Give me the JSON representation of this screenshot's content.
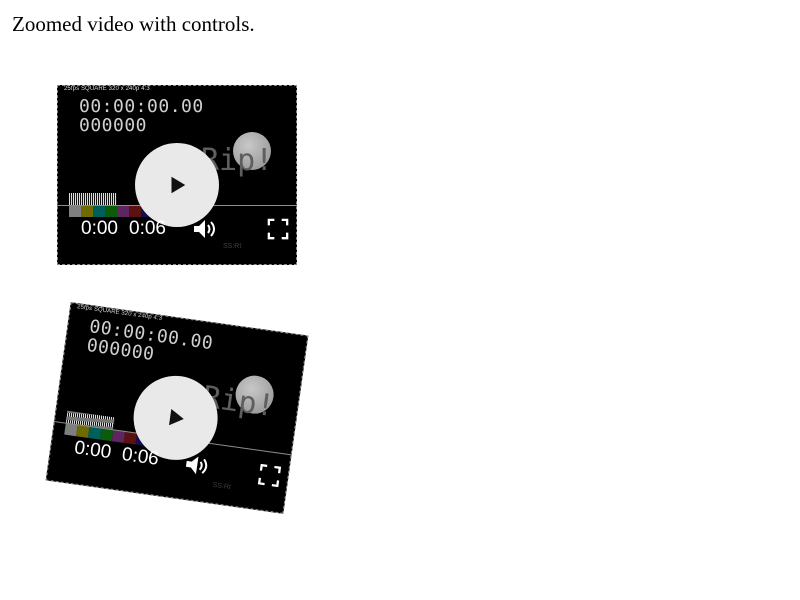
{
  "page": {
    "title": "Zoomed video with controls."
  },
  "video": {
    "info_text": "25fps SQUARE 320 x 240p 4:3",
    "timecode": "00:00:00.00",
    "frame_count": "000000",
    "brand": "Rip!",
    "small_label": "SS:Rt"
  },
  "controls": {
    "current_time": "0:00",
    "duration": "0:06",
    "play_icon": "play-icon",
    "volume_icon": "volume-icon",
    "fullscreen_icon": "fullscreen-icon"
  },
  "colors": {
    "video_background": "#000000",
    "play_button_fill": "#e9e9e9",
    "text_color": "#ffffff",
    "color_bars": [
      "#7f7f7f",
      "#6e6b00",
      "#005f5b",
      "#0a5b0a",
      "#5f2560",
      "#5b1111",
      "#10104d"
    ]
  }
}
